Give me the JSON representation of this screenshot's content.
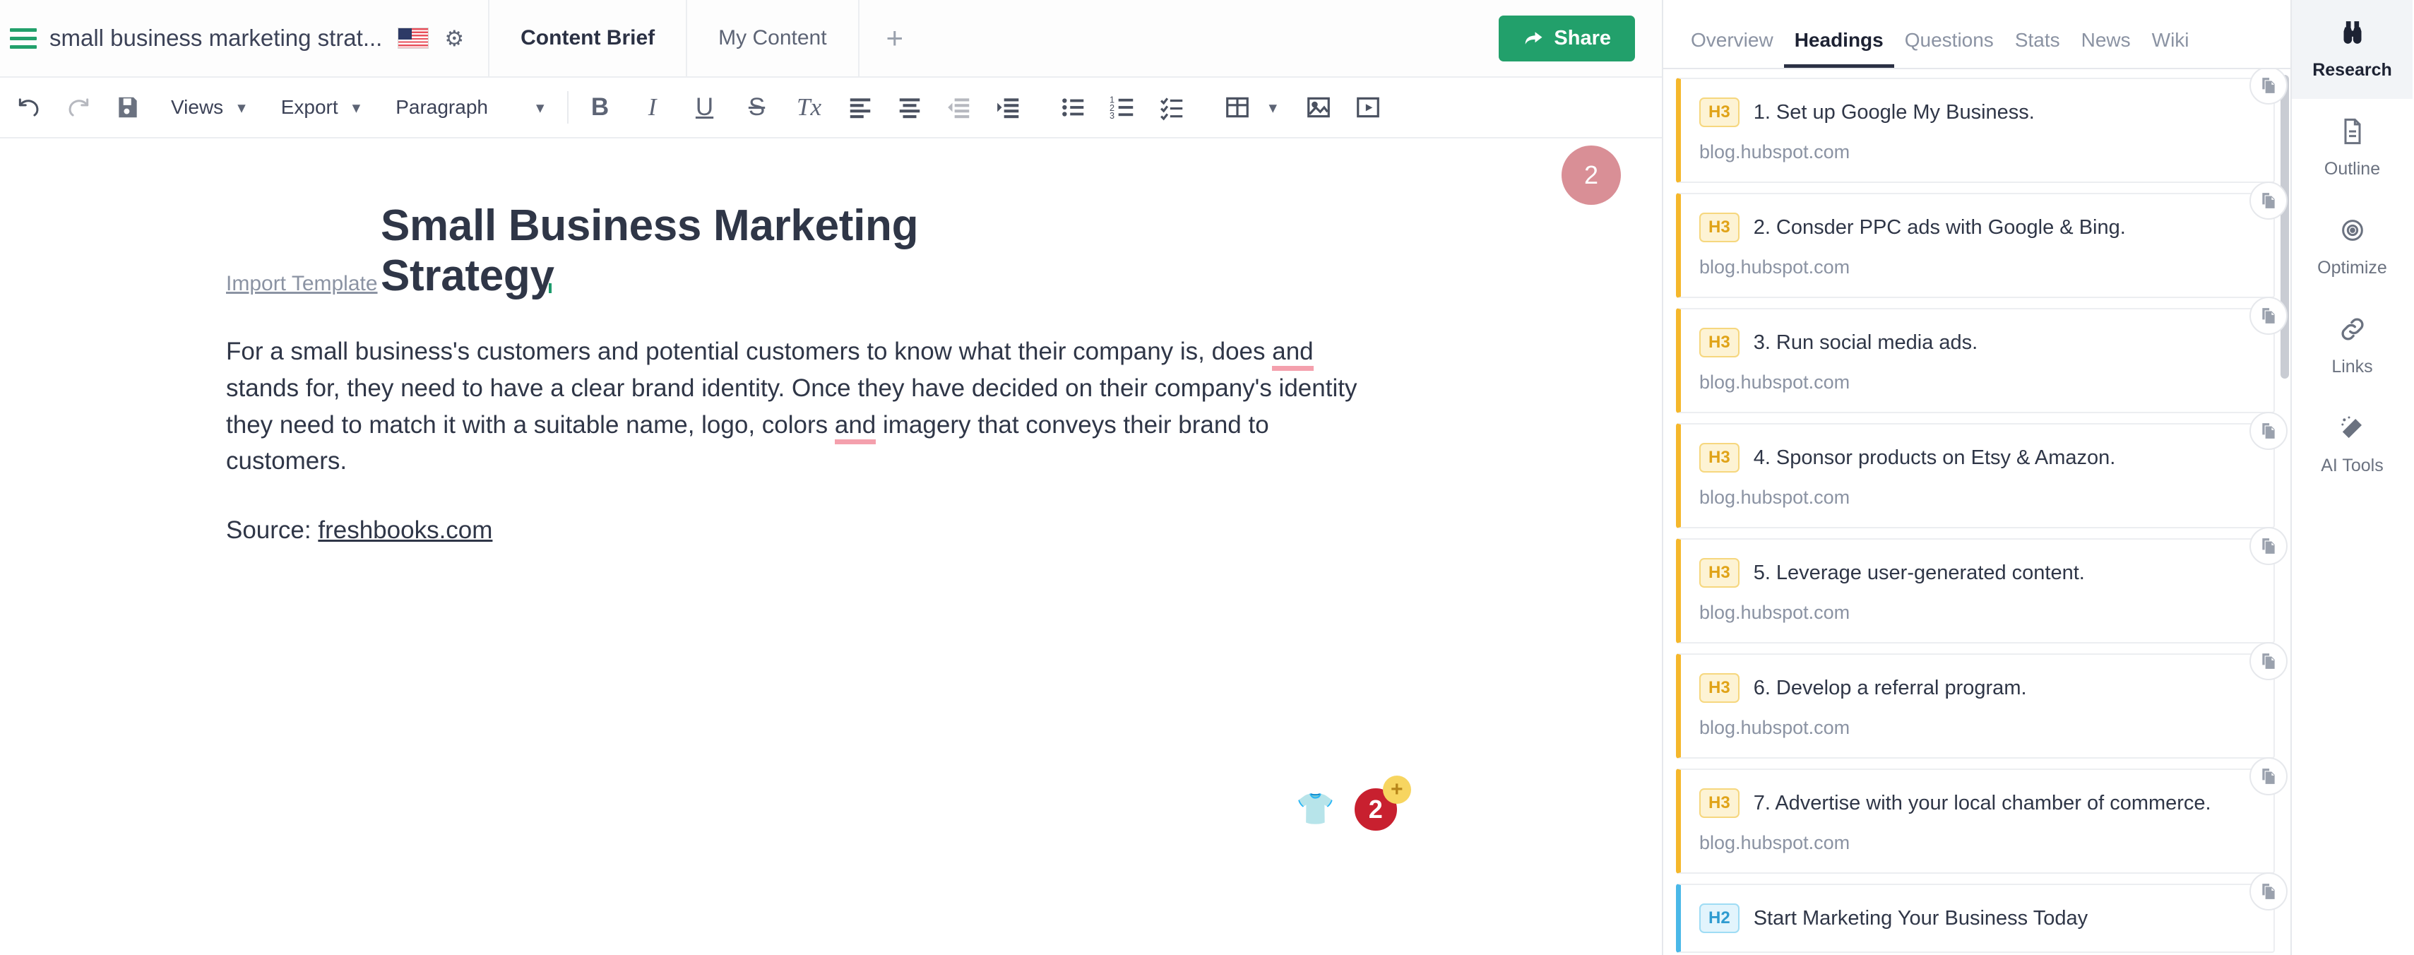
{
  "topbar": {
    "menu_icon": "hamburger-icon",
    "doc_title": "small business marketing strat...",
    "locale_flag": "us-flag-icon",
    "settings_icon": "gear-icon",
    "tabs": [
      {
        "label": "Content Brief",
        "active": true
      },
      {
        "label": "My Content",
        "active": false
      }
    ],
    "add_tab_label": "+",
    "share_label": "Share"
  },
  "toolbar": {
    "undo_icon": "undo-icon",
    "redo_icon": "redo-icon",
    "save_icon": "save-icon",
    "views_label": "Views",
    "export_label": "Export",
    "style_label": "Paragraph",
    "bold_label": "B",
    "italic_label": "I",
    "underline_label": "U",
    "strike_label": "S",
    "clear_format_label": "Tx",
    "align_left_icon": "align-left-icon",
    "align_center_icon": "align-center-icon",
    "outdent_icon": "outdent-icon",
    "indent_icon": "indent-icon",
    "bullet_list_icon": "bullet-list-icon",
    "numbered_list_icon": "numbered-list-icon",
    "checklist_icon": "checklist-icon",
    "table_icon": "table-icon",
    "image_icon": "image-icon",
    "video_icon": "video-icon"
  },
  "document": {
    "import_link": "Import Template",
    "title": "Small Business Marketing Strategy",
    "paragraph_parts": [
      {
        "t": "For a small business's customers and potential customers to know what their company is, does ",
        "flag": false
      },
      {
        "t": "and",
        "flag": true
      },
      {
        "t": " stands for, they need to have a clear brand identity. Once they have decided on their company's identity they need to match it with a suitable name, logo, colors ",
        "flag": false
      },
      {
        "t": "and",
        "flag": true
      },
      {
        "t": " imagery that conveys their brand to customers.",
        "flag": false
      }
    ],
    "source_label": "Source: ",
    "source_link": "freshbooks.com",
    "count_badge": "2",
    "shirt_icon": "shirt-icon",
    "score_badge": "2",
    "score_plus": "+"
  },
  "research_panel": {
    "tabs": [
      {
        "label": "Overview",
        "active": false
      },
      {
        "label": "Headings",
        "active": true
      },
      {
        "label": "Questions",
        "active": false
      },
      {
        "label": "Stats",
        "active": false
      },
      {
        "label": "News",
        "active": false
      },
      {
        "label": "Wiki",
        "active": false
      }
    ],
    "copy_icon": "copy-icon",
    "headings": [
      {
        "tag": "H3",
        "text": "1. Set up Google My Business.",
        "url": "blog.hubspot.com"
      },
      {
        "tag": "H3",
        "text": "2. Consder PPC ads with Google & Bing.",
        "url": "blog.hubspot.com"
      },
      {
        "tag": "H3",
        "text": "3. Run social media ads.",
        "url": "blog.hubspot.com"
      },
      {
        "tag": "H3",
        "text": "4. Sponsor products on Etsy & Amazon.",
        "url": "blog.hubspot.com"
      },
      {
        "tag": "H3",
        "text": "5. Leverage user-generated content.",
        "url": "blog.hubspot.com"
      },
      {
        "tag": "H3",
        "text": "6. Develop a referral program.",
        "url": "blog.hubspot.com"
      },
      {
        "tag": "H3",
        "text": "7. Advertise with your local chamber of commerce.",
        "url": "blog.hubspot.com"
      },
      {
        "tag": "H2",
        "text": "Start Marketing Your Business Today",
        "url": ""
      }
    ]
  },
  "rail": {
    "items": [
      {
        "label": "Research",
        "icon": "binoculars-icon",
        "active": true
      },
      {
        "label": "Outline",
        "icon": "document-icon",
        "active": false
      },
      {
        "label": "Optimize",
        "icon": "target-icon",
        "active": false
      },
      {
        "label": "Links",
        "icon": "link-icon",
        "active": false
      },
      {
        "label": "AI Tools",
        "icon": "magic-wand-icon",
        "active": false
      }
    ]
  },
  "colors": {
    "brand_green": "#22a06b",
    "h3_accent": "#f5b72b",
    "h2_accent": "#4ab8e8",
    "spell_underline": "#f4a0ad",
    "badge_rose": "#d98f96",
    "score_red": "#c8202f"
  }
}
